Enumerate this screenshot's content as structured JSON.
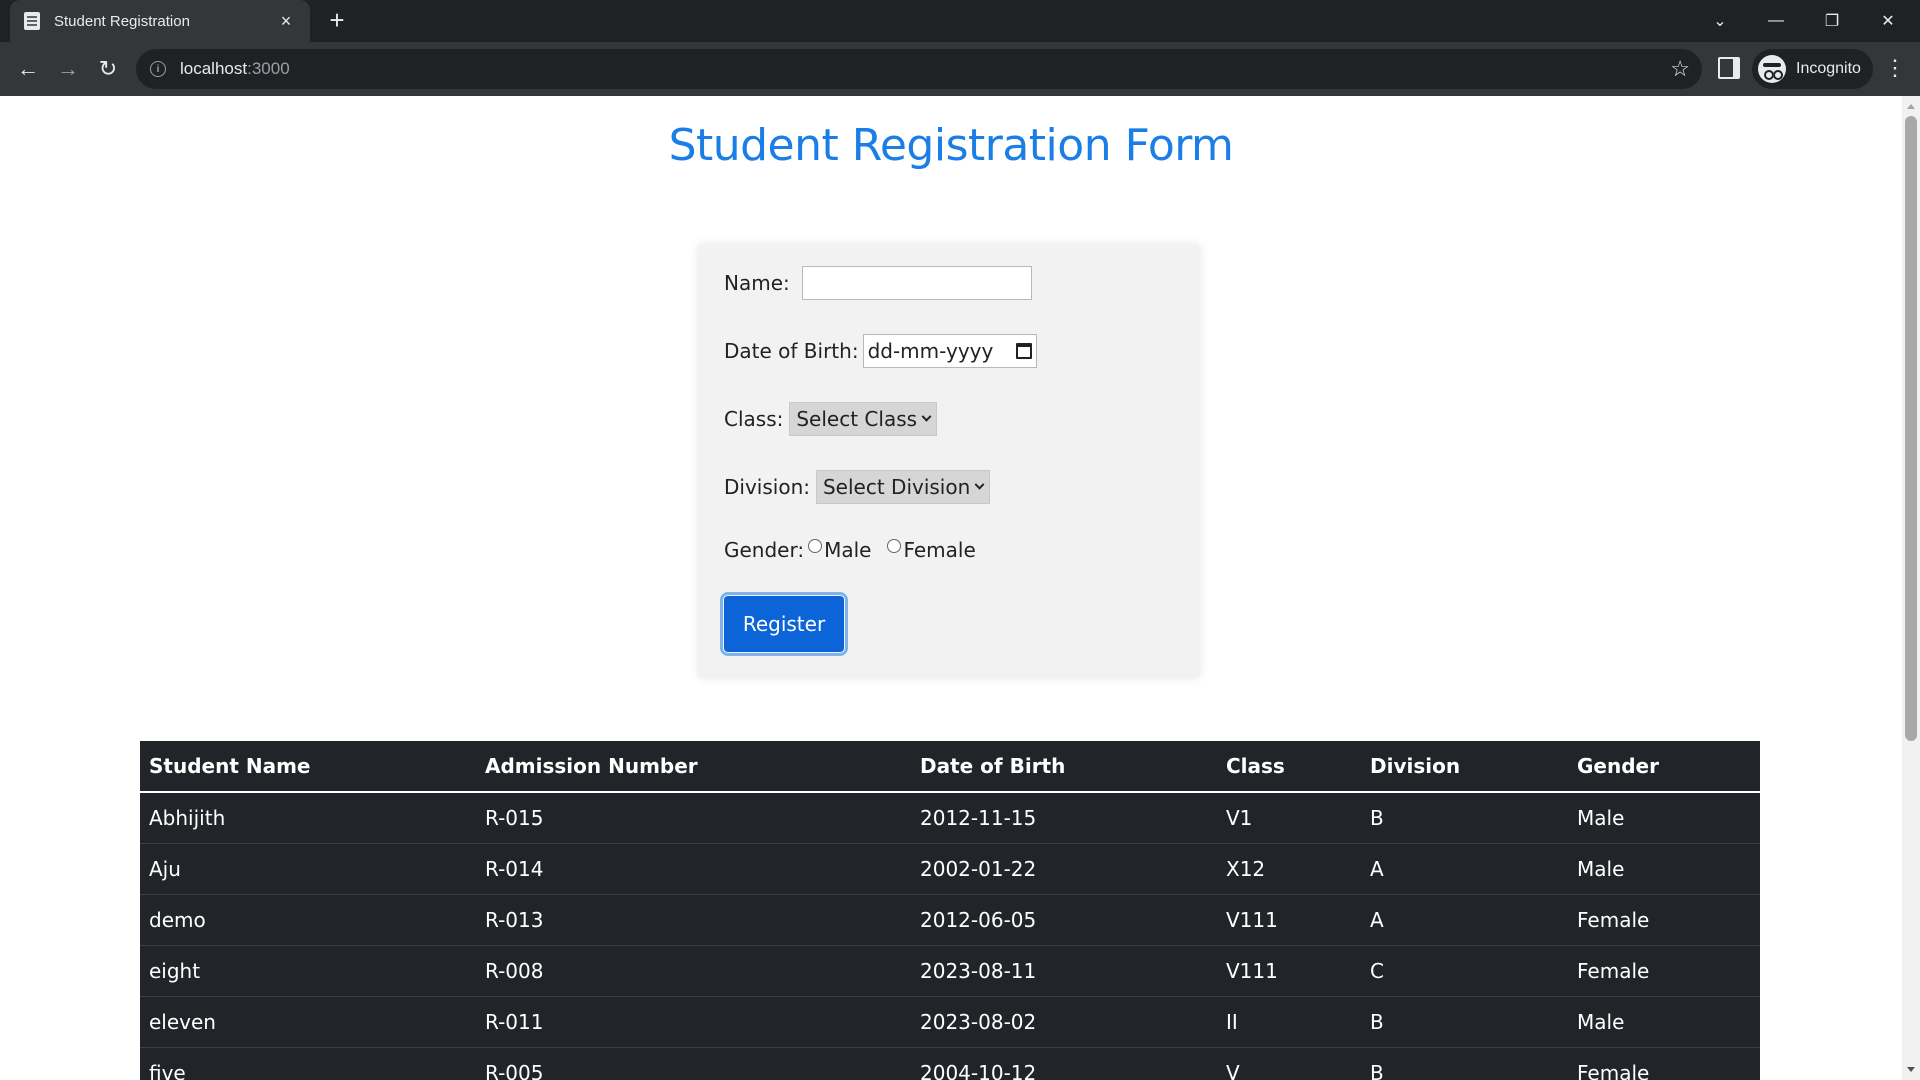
{
  "browser": {
    "tab_title": "Student Registration",
    "tab_close": "×",
    "new_tab": "+",
    "url_host": "localhost",
    "url_port": ":3000",
    "profile_label": "Incognito"
  },
  "page": {
    "title": "Student Registration Form"
  },
  "form": {
    "name_label": "Name:",
    "name_value": "",
    "dob_label": "Date of Birth:",
    "dob_placeholder": "dd-mm-yyyy",
    "class_label": "Class:",
    "class_selected": "Select Class",
    "division_label": "Division:",
    "division_selected": "Select Division",
    "gender_label": "Gender:",
    "gender_options": [
      "Male",
      "Female"
    ],
    "register_label": "Register"
  },
  "table": {
    "headers": [
      "Student Name",
      "Admission Number",
      "Date of Birth",
      "Class",
      "Division",
      "Gender"
    ],
    "rows": [
      [
        "Abhijith",
        "R-015",
        "2012-11-15",
        "V1",
        "B",
        "Male"
      ],
      [
        "Aju",
        "R-014",
        "2002-01-22",
        "X12",
        "A",
        "Male"
      ],
      [
        "demo",
        "R-013",
        "2012-06-05",
        "V111",
        "A",
        "Female"
      ],
      [
        "eight",
        "R-008",
        "2023-08-11",
        "V111",
        "C",
        "Female"
      ],
      [
        "eleven",
        "R-011",
        "2023-08-02",
        "II",
        "B",
        "Male"
      ],
      [
        "five",
        "R-005",
        "2004-10-12",
        "V",
        "B",
        "Female"
      ]
    ]
  }
}
